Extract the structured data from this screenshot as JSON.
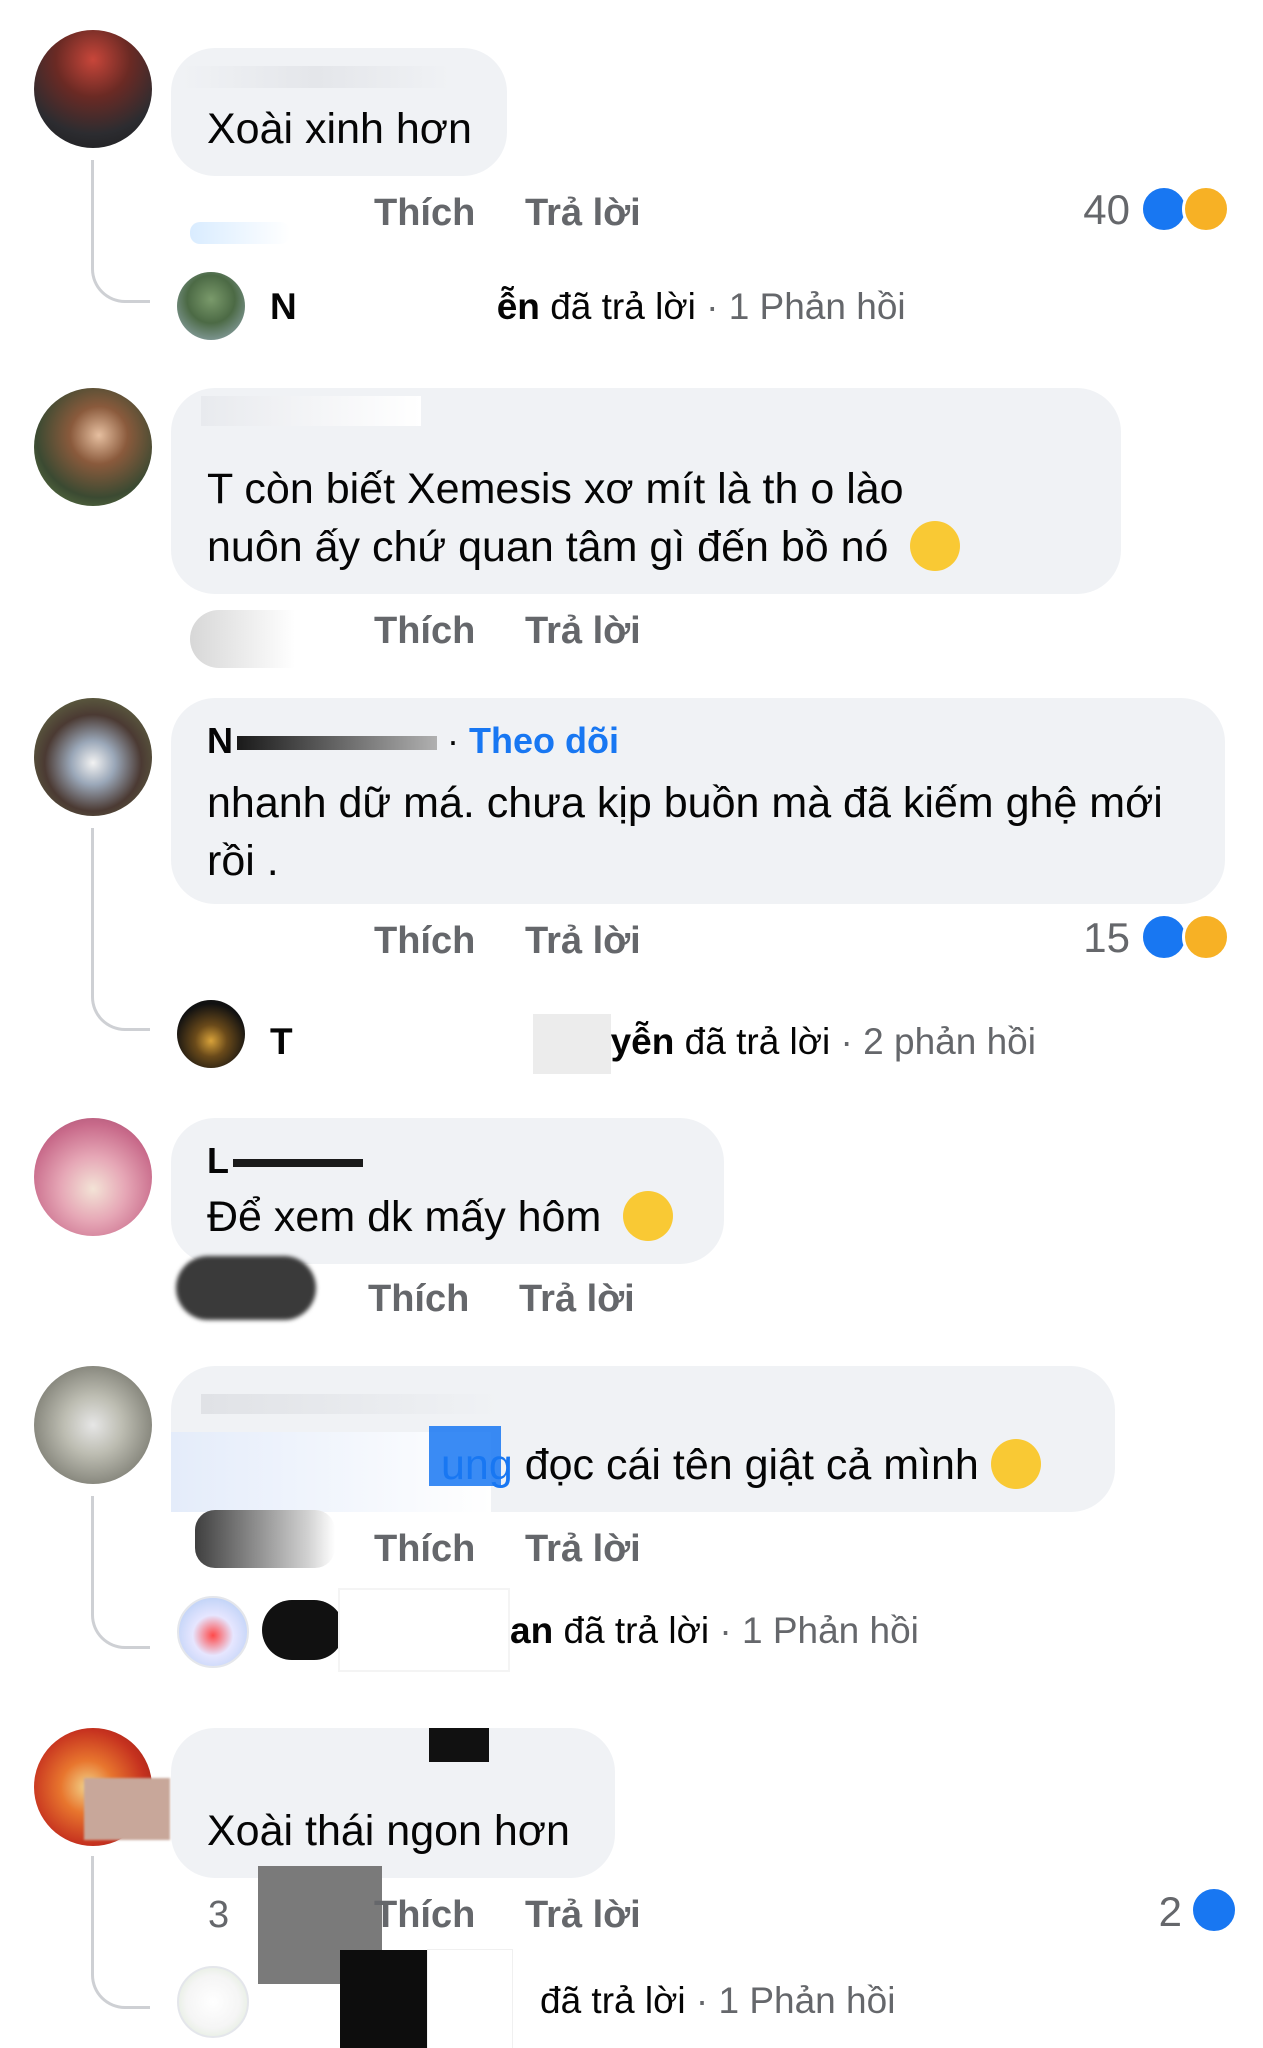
{
  "actions": {
    "like": "Thích",
    "reply": "Trả lời"
  },
  "comments": [
    {
      "text": "Xoài xinh hơn",
      "reaction_count": "40",
      "reply_summary": {
        "name_fragment": "ễn",
        "replied": "đã trả lời",
        "count": "· 1 Phản hồi"
      }
    },
    {
      "text_line1": "T còn      biết Xemesis xơ mít là th        o lào",
      "text_line2": "nuôn ấy chứ quan tâm gì đến bồ nó"
    },
    {
      "name_fragment": "N",
      "follow_sep": " · ",
      "follow": "Theo dõi",
      "text_line1": "nhanh dữ má. chưa kịp buồn mà đã kiếm ghệ mới",
      "text_line2": "rồi .",
      "reaction_count": "15",
      "reply_summary": {
        "initial": "T",
        "name_fragment": "yễn",
        "replied": "đã trả lời",
        "count": "· 2 phản hồi"
      }
    },
    {
      "name_fragment": "L",
      "text": "Để xem dk mấy hôm"
    },
    {
      "mention_fragment": "ung",
      "text": " đọc cái tên giật cả mình",
      "reply_summary": {
        "name_fragment": "an",
        "replied": "đã trả lời",
        "count": "· 1 Phản hồi"
      }
    },
    {
      "text": "Xoài thái ngon hơn",
      "time": "3",
      "reaction_count": "2",
      "reply_summary": {
        "replied": "đã trả lời",
        "count": "· 1 Phản hồi"
      }
    }
  ]
}
